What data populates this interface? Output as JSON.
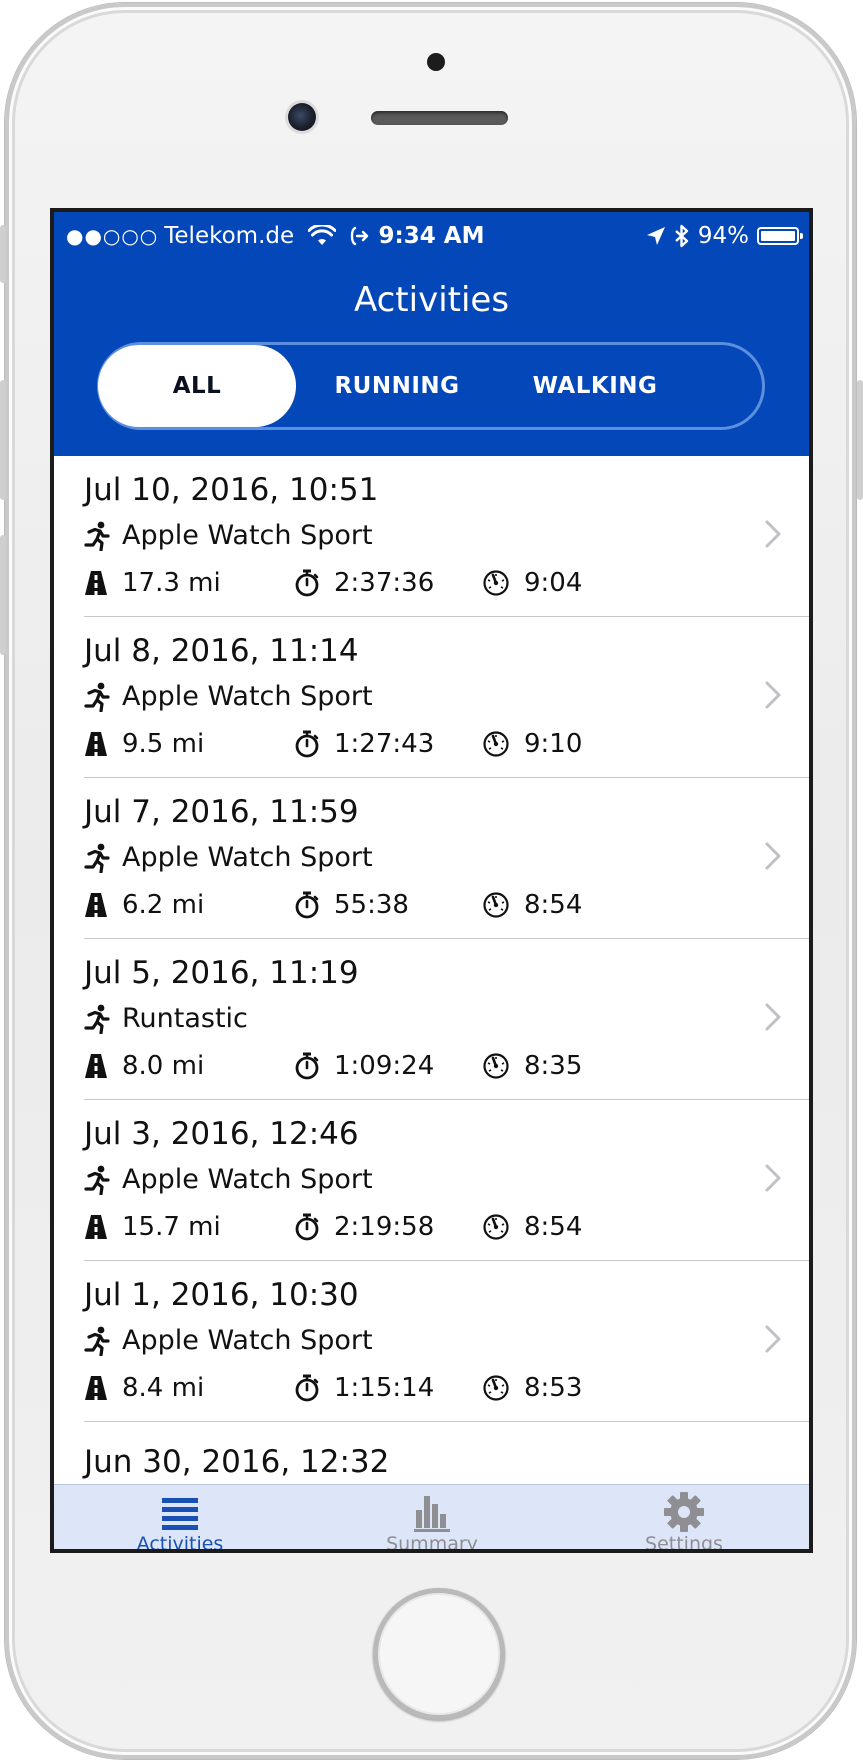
{
  "status_bar": {
    "signal": "●●○○○",
    "carrier": "Telekom.de",
    "time": "9:34 AM",
    "battery": "94%",
    "battery_level": 0.94
  },
  "nav": {
    "title": "Activities",
    "segments": [
      "ALL",
      "RUNNING",
      "WALKING"
    ],
    "selected_segment": "ALL"
  },
  "activities": [
    {
      "date": "Jul 10, 2016, 10:51",
      "source": "Apple Watch Sport",
      "distance": "17.3 mi",
      "duration": "2:37:36",
      "pace": "9:04"
    },
    {
      "date": "Jul 8, 2016, 11:14",
      "source": "Apple Watch Sport",
      "distance": "9.5 mi",
      "duration": "1:27:43",
      "pace": "9:10"
    },
    {
      "date": "Jul 7, 2016, 11:59",
      "source": "Apple Watch Sport",
      "distance": "6.2 mi",
      "duration": "55:38",
      "pace": "8:54"
    },
    {
      "date": "Jul 5, 2016, 11:19",
      "source": "Runtastic",
      "distance": "8.0 mi",
      "duration": "1:09:24",
      "pace": "8:35"
    },
    {
      "date": "Jul 3, 2016, 12:46",
      "source": "Apple Watch Sport",
      "distance": "15.7 mi",
      "duration": "2:19:58",
      "pace": "8:54"
    },
    {
      "date": "Jul 1, 2016, 10:30",
      "source": "Apple Watch Sport",
      "distance": "8.4 mi",
      "duration": "1:15:14",
      "pace": "8:53"
    },
    {
      "date": "Jun 30, 2016, 12:32"
    }
  ],
  "tab_bar": {
    "tabs": [
      {
        "label": "Activities",
        "icon": "list-icon",
        "selected": true
      },
      {
        "label": "Summary",
        "icon": "bar-chart-icon",
        "selected": false
      },
      {
        "label": "Settings",
        "icon": "gear-icon",
        "selected": false
      }
    ]
  },
  "colors": {
    "nav_blue": "#0447b8",
    "tab_bar_bg": "#dce6f8",
    "tab_active": "#1a4fb3",
    "tab_inactive": "#8e8e93"
  }
}
